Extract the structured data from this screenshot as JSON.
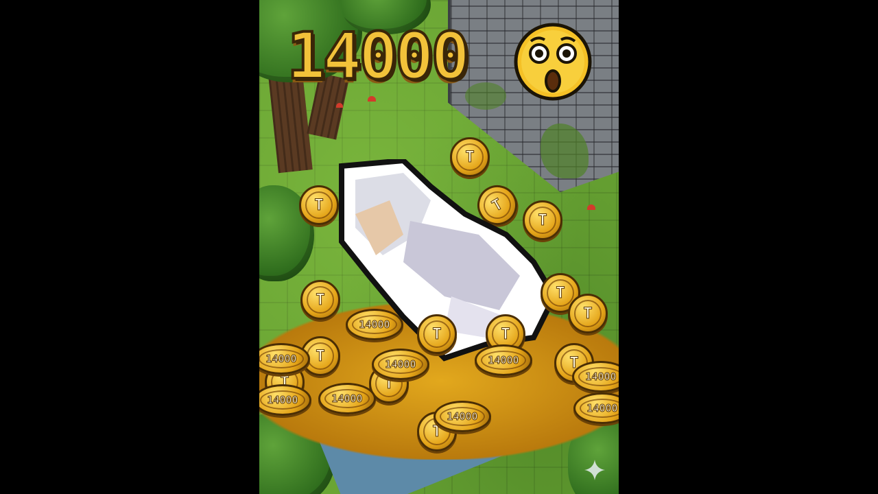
{
  "game": {
    "counter_text": "14000",
    "coin_symbol": "T",
    "coin_value_text": "14000",
    "emoji_icon": "astonished-face-icon",
    "sparkle_icon": "sparkle-icon"
  },
  "colors": {
    "grass": "#6aa534",
    "gold": "#f2c23a",
    "stone": "#7a7f84",
    "water": "#5d8aa8"
  }
}
